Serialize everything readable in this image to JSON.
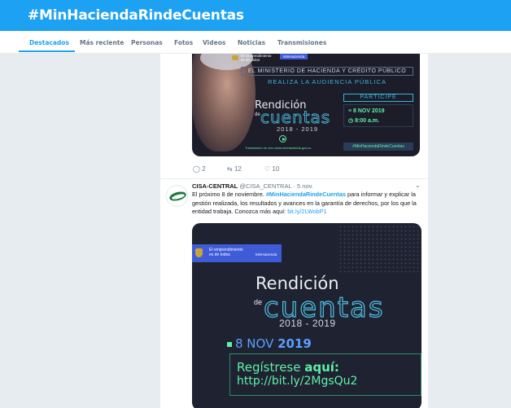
{
  "header": {
    "title": "#MinHaciendaRindeCuentas"
  },
  "tabs": [
    "Destacados",
    "Más reciente",
    "Personas",
    "Fotos",
    "Videos",
    "Noticias",
    "Transmisiones"
  ],
  "tweet1": {
    "image": {
      "gov_badge": "El emprendimiento es de todos",
      "min_badge": "MinHacienda",
      "ministry": "EL MINISTERIO DE HACIENDA Y CRÉDITO PÚBLICO",
      "realiza": "REALIZA LA AUDIENCIA PÚBLICA",
      "rendicion": "Rendición",
      "de": "de",
      "cuentas": "cuentas",
      "years": "2018 - 2019",
      "participe": "PARTICIPE",
      "date": "8 NOV 2019",
      "time": "8:00 a.m.",
      "transmision": "Transmisión en vivo www.minhacienda.gov.co",
      "hashtag": "#MinHaciendaRindeCuentas"
    },
    "actions": {
      "replies": "2",
      "retweets": "12",
      "likes": "10"
    }
  },
  "tweet2": {
    "name": "CISA-CENTRAL",
    "handle": "@CISA_CENTRAL · 5 nov.",
    "text_1": "El próximo 8 de noviembre. ",
    "hashtag": "#MinHaciendaRindeCuentas",
    "text_2": " para informar y explicar la gestión realizada, los resultados y avances en la garantía de derechos, por los que la entidad trabaja. Conozca más aquí: ",
    "link": "bit.ly/2LWobP1",
    "image": {
      "gov_badge": "El emprendimiento es de todos",
      "min_badge": "MinHacienda",
      "rendicion": "Rendición",
      "de": "de",
      "cuentas": "cuentas",
      "years": "2018 - 2019",
      "date_a": "8 NOV ",
      "date_b": "2019",
      "reg_a": "Regístrese ",
      "reg_b": "aquí:",
      "url": "http://bit.ly/2MgsQu2"
    }
  },
  "colors": {
    "brand": "#1da1f2",
    "accent_green": "#5ff0a8",
    "accent_cyan": "#4fc3e7"
  }
}
